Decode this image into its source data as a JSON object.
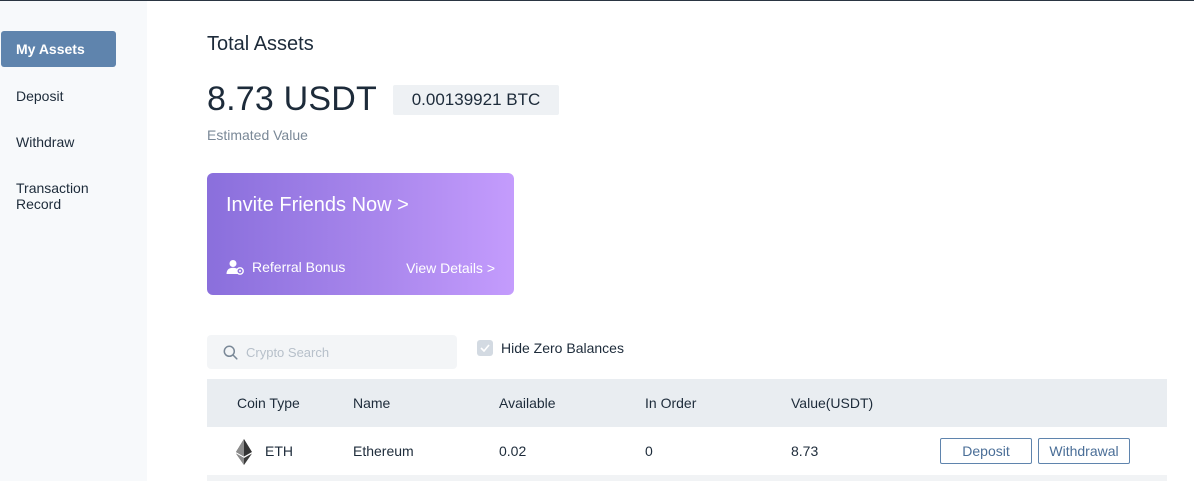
{
  "sidebar": {
    "items": [
      {
        "label": "My Assets",
        "active": true
      },
      {
        "label": "Deposit"
      },
      {
        "label": "Withdraw"
      },
      {
        "label": "Transaction Record"
      }
    ]
  },
  "summary": {
    "title": "Total Assets",
    "usdt_value": "8.73 USDT",
    "btc_value": "0.00139921 BTC",
    "estimated_label": "Estimated Value"
  },
  "invite": {
    "title": "Invite Friends Now >",
    "referral_label": "Referral Bonus",
    "view_details": "View Details >"
  },
  "search": {
    "placeholder": "Crypto Search",
    "value": ""
  },
  "hide_zero": {
    "label": "Hide Zero Balances",
    "checked": true
  },
  "table": {
    "columns": [
      "Coin Type",
      "Name",
      "Available",
      "In Order",
      "Value(USDT)"
    ],
    "rows": [
      {
        "coin": "ETH",
        "name": "Ethereum",
        "available": "0.02",
        "in_order": "0",
        "value": "8.73",
        "deposit_label": "Deposit",
        "withdraw_label": "Withdrawal"
      }
    ]
  },
  "colors": {
    "accent": "#5f84ad",
    "card_gradient_start": "#8a6fdc",
    "card_gradient_end": "#c49cfd"
  }
}
